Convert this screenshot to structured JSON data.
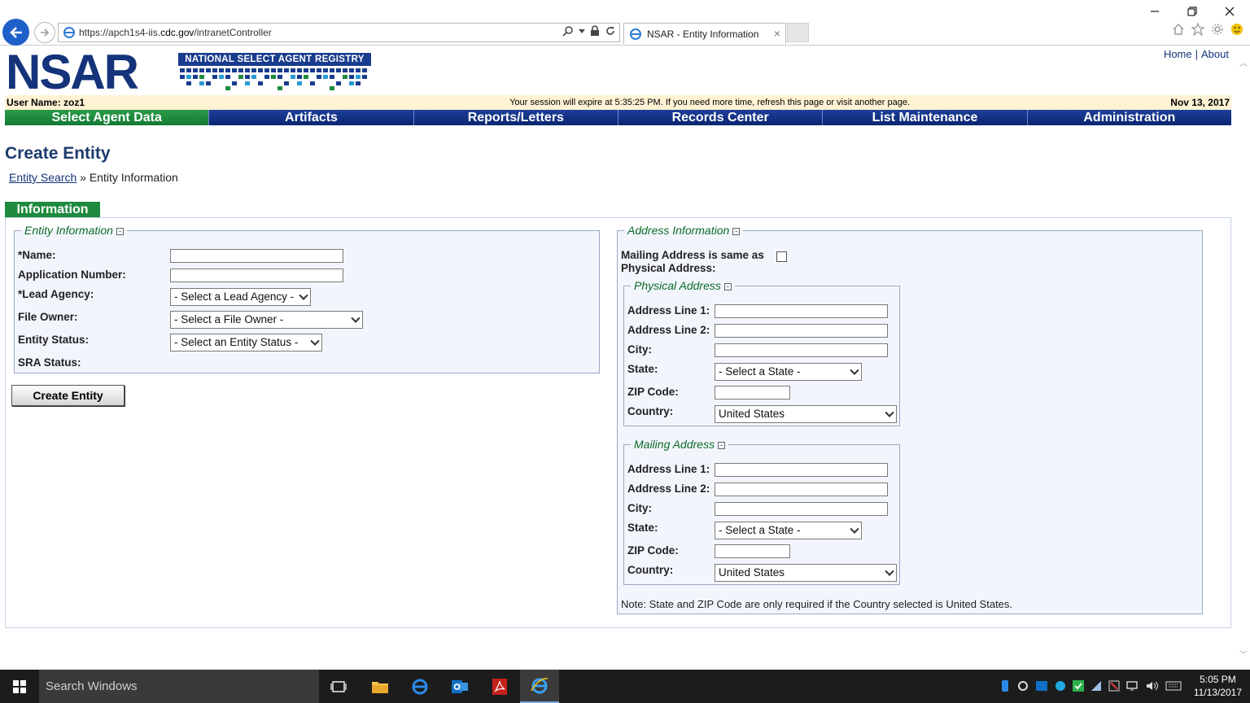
{
  "browser": {
    "url_prefix": "https://apch1s4-iis.",
    "url_domain": "cdc.gov",
    "url_path": "/intranetController",
    "tab_title": "NSAR - Entity Information",
    "tab_close": "×"
  },
  "site": {
    "logo_text": "NSAR",
    "logo_banner": "NATIONAL SELECT AGENT REGISTRY",
    "top_links": {
      "home": "Home",
      "sep": "|",
      "about": "About"
    },
    "user_name": "User Name: zoz1",
    "session_msg": "Your session will expire at 5:35:25 PM. If you need more time, refresh this page or visit another page.",
    "date": "Nov 13, 2017"
  },
  "menu": [
    {
      "label": "Select Agent Data",
      "active": true
    },
    {
      "label": "Artifacts",
      "active": false
    },
    {
      "label": "Reports/Letters",
      "active": false
    },
    {
      "label": "Records Center",
      "active": false
    },
    {
      "label": "List Maintenance",
      "active": false
    },
    {
      "label": "Administration",
      "active": false
    }
  ],
  "page": {
    "title": "Create Entity",
    "breadcrumb_link": "Entity Search",
    "breadcrumb_sep": "»",
    "breadcrumb_current": "Entity Information",
    "section_tab": "Information"
  },
  "entity": {
    "legend": "Entity Information",
    "name_label": "*Name:",
    "name_value": "",
    "app_label": "Application Number:",
    "app_value": "",
    "lead_label": "*Lead Agency:",
    "lead_value": "- Select a Lead Agency -",
    "owner_label": "File Owner:",
    "owner_value": "- Select a File Owner -",
    "status_label": "Entity Status:",
    "status_value": "- Select an Entity Status -",
    "sra_label": "SRA Status:",
    "create_button": "Create Entity"
  },
  "address": {
    "legend": "Address Information",
    "same_label_1": "Mailing Address is same as",
    "same_label_2": "Physical Address:",
    "same_checked": false,
    "physical": {
      "legend": "Physical Address",
      "line1_label": "Address Line 1:",
      "line2_label": "Address Line 2:",
      "city_label": "City:",
      "state_label": "State:",
      "state_value": "- Select a State -",
      "zip_label": "ZIP Code:",
      "country_label": "Country:",
      "country_value": "United States"
    },
    "mailing": {
      "legend": "Mailing Address",
      "line1_label": "Address Line 1:",
      "line2_label": "Address Line 2:",
      "city_label": "City:",
      "state_label": "State:",
      "state_value": "- Select a State -",
      "zip_label": "ZIP Code:",
      "country_label": "Country:",
      "country_value": "United States"
    },
    "note": "Note: State and ZIP Code are only required if the Country selected is United States."
  },
  "taskbar": {
    "search_placeholder": "Search Windows",
    "time": "5:05 PM",
    "date": "11/13/2017"
  },
  "colors": {
    "nav_blue": "#0b2570",
    "nav_green": "#137a33",
    "logo_blue": "#14337a",
    "session_bar": "#fff3d4",
    "legend_green": "#0b6a2a"
  }
}
